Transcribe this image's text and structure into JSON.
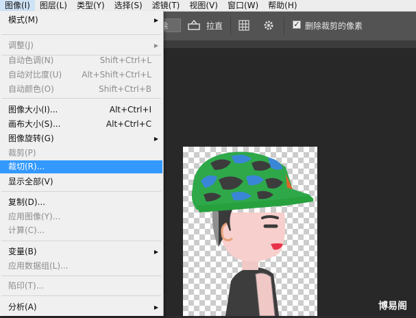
{
  "menubar": {
    "items": [
      {
        "label": "图像(I)",
        "active": true
      },
      {
        "label": "图层(L)"
      },
      {
        "label": "类型(Y)"
      },
      {
        "label": "选择(S)"
      },
      {
        "label": "滤镜(T)"
      },
      {
        "label": "视图(V)"
      },
      {
        "label": "窗口(W)"
      },
      {
        "label": "帮助(H)"
      }
    ]
  },
  "options": {
    "button_partial": "除",
    "straighten_label": "拉直",
    "delete_cropped_label": "删除裁剪的像素",
    "delete_cropped_checked": true
  },
  "menu": {
    "items": [
      {
        "label": "模式(M)",
        "shortcut": "",
        "submenu": true,
        "disabled": false
      },
      {
        "label": "调整(J)",
        "shortcut": "",
        "submenu": true,
        "disabled": true
      },
      {
        "label": "自动色调(N)",
        "shortcut": "Shift+Ctrl+L",
        "disabled": true
      },
      {
        "label": "自动对比度(U)",
        "shortcut": "Alt+Shift+Ctrl+L",
        "disabled": true
      },
      {
        "label": "自动颜色(O)",
        "shortcut": "Shift+Ctrl+B",
        "disabled": true
      },
      {
        "label": "图像大小(I)...",
        "shortcut": "Alt+Ctrl+I",
        "disabled": false
      },
      {
        "label": "画布大小(S)...",
        "shortcut": "Alt+Ctrl+C",
        "disabled": false
      },
      {
        "label": "图像旋转(G)",
        "shortcut": "",
        "submenu": true,
        "disabled": false
      },
      {
        "label": "裁剪(P)",
        "shortcut": "",
        "disabled": true
      },
      {
        "label": "裁切(R)...",
        "shortcut": "",
        "disabled": false,
        "highlighted": true
      },
      {
        "label": "显示全部(V)",
        "shortcut": "",
        "disabled": false
      },
      {
        "label": "复制(D)...",
        "shortcut": "",
        "disabled": false
      },
      {
        "label": "应用图像(Y)...",
        "shortcut": "",
        "disabled": true
      },
      {
        "label": "计算(C)...",
        "shortcut": "",
        "disabled": true
      },
      {
        "label": "变量(B)",
        "shortcut": "",
        "submenu": true,
        "disabled": false
      },
      {
        "label": "应用数据组(L)...",
        "shortcut": "",
        "disabled": true
      },
      {
        "label": "陷印(T)...",
        "shortcut": "",
        "disabled": true
      },
      {
        "label": "分析(A)",
        "shortcut": "",
        "submenu": true,
        "disabled": false
      }
    ]
  },
  "watermark": "博易阁",
  "colors": {
    "highlight": "#3399ff",
    "menu_bg": "#f0f0f0",
    "options_bar": "#535353",
    "workspace": "#282828"
  }
}
